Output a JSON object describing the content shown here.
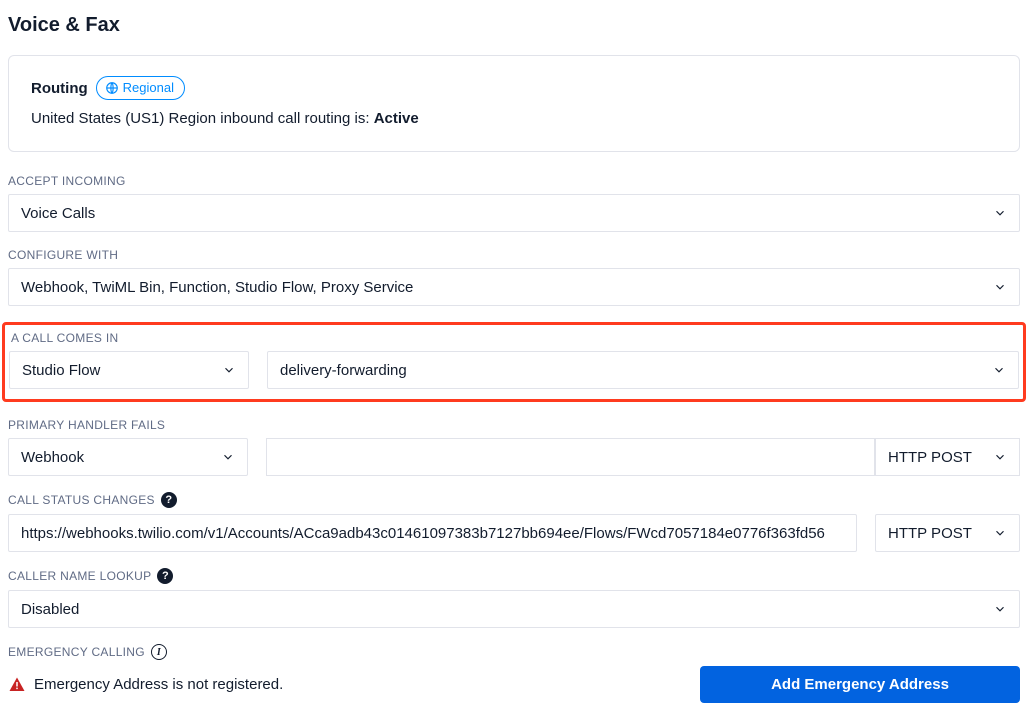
{
  "title": "Voice & Fax",
  "routing": {
    "heading": "Routing",
    "badge": "Regional",
    "status_prefix": "United States (US1) Region inbound call routing is: ",
    "status_value": "Active"
  },
  "accept_incoming": {
    "label": "ACCEPT INCOMING",
    "value": "Voice Calls"
  },
  "configure_with": {
    "label": "CONFIGURE WITH",
    "value": "Webhook, TwiML Bin, Function, Studio Flow, Proxy Service"
  },
  "call_comes_in": {
    "label": "A CALL COMES IN",
    "handler": "Studio Flow",
    "target": "delivery-forwarding"
  },
  "primary_handler_fails": {
    "label": "PRIMARY HANDLER FAILS",
    "handler": "Webhook",
    "url": "",
    "method": "HTTP POST"
  },
  "call_status_changes": {
    "label": "CALL STATUS CHANGES",
    "url": "https://webhooks.twilio.com/v1/Accounts/ACca9adb43c01461097383b7127bb694ee/Flows/FWcd7057184e0776f363fd56",
    "method": "HTTP POST"
  },
  "caller_name_lookup": {
    "label": "CALLER NAME LOOKUP",
    "value": "Disabled"
  },
  "emergency": {
    "label": "EMERGENCY CALLING",
    "warning": "Emergency Address is not registered.",
    "button": "Add Emergency Address"
  }
}
